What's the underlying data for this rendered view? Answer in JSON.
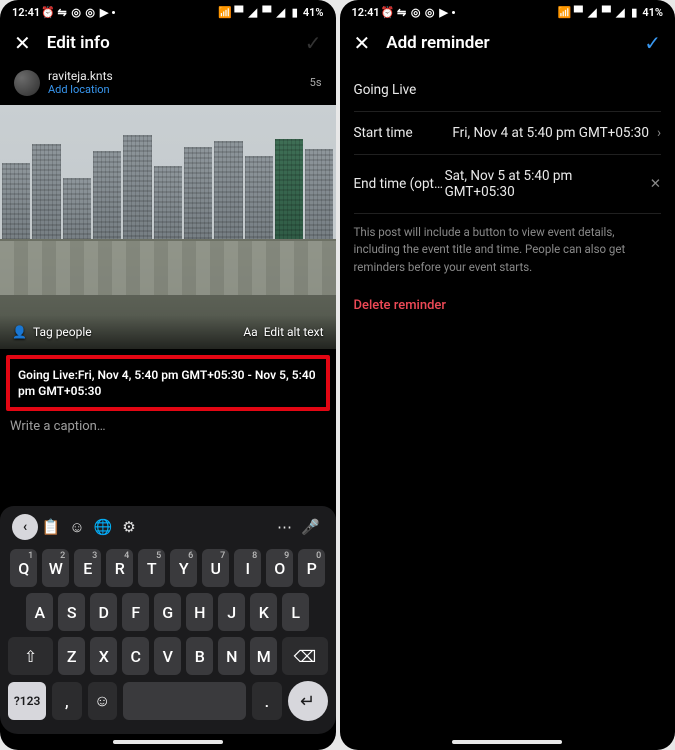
{
  "status": {
    "time": "12:41",
    "battery": "41%"
  },
  "left": {
    "title": "Edit info",
    "user": {
      "name": "raviteja.knts",
      "addLocation": "Add location",
      "timestamp": "5s"
    },
    "photo": {
      "tagPeople": "Tag people",
      "editAlt": "Edit alt text"
    },
    "eventBanner": "Going Live:Fri, Nov 4, 5:40 pm GMT+05:30 - Nov 5, 5:40 pm GMT+05:30",
    "captionPlaceholder": "Write a caption…",
    "keyboard": {
      "row1": [
        "Q",
        "W",
        "E",
        "R",
        "T",
        "Y",
        "U",
        "I",
        "O",
        "P"
      ],
      "row2": [
        "A",
        "S",
        "D",
        "F",
        "G",
        "H",
        "J",
        "K",
        "L"
      ],
      "row3": [
        "Z",
        "X",
        "C",
        "V",
        "B",
        "N",
        "M"
      ],
      "sym": "?123",
      "numhints": [
        "1",
        "2",
        "3",
        "4",
        "5",
        "6",
        "7",
        "8",
        "9",
        "0"
      ]
    }
  },
  "right": {
    "title": "Add reminder",
    "eventTitle": "Going Live",
    "start": {
      "label": "Start time",
      "value": "Fri, Nov 4 at 5:40 pm GMT+05:30"
    },
    "end": {
      "label": "End time (optional)",
      "labelShort": "End time (opti…",
      "value": "Sat, Nov 5 at 5:40 pm GMT+05:30"
    },
    "note": "This post will include a button to view event details, including the event title and time. People can also get reminders before your event starts.",
    "delete": "Delete reminder"
  }
}
